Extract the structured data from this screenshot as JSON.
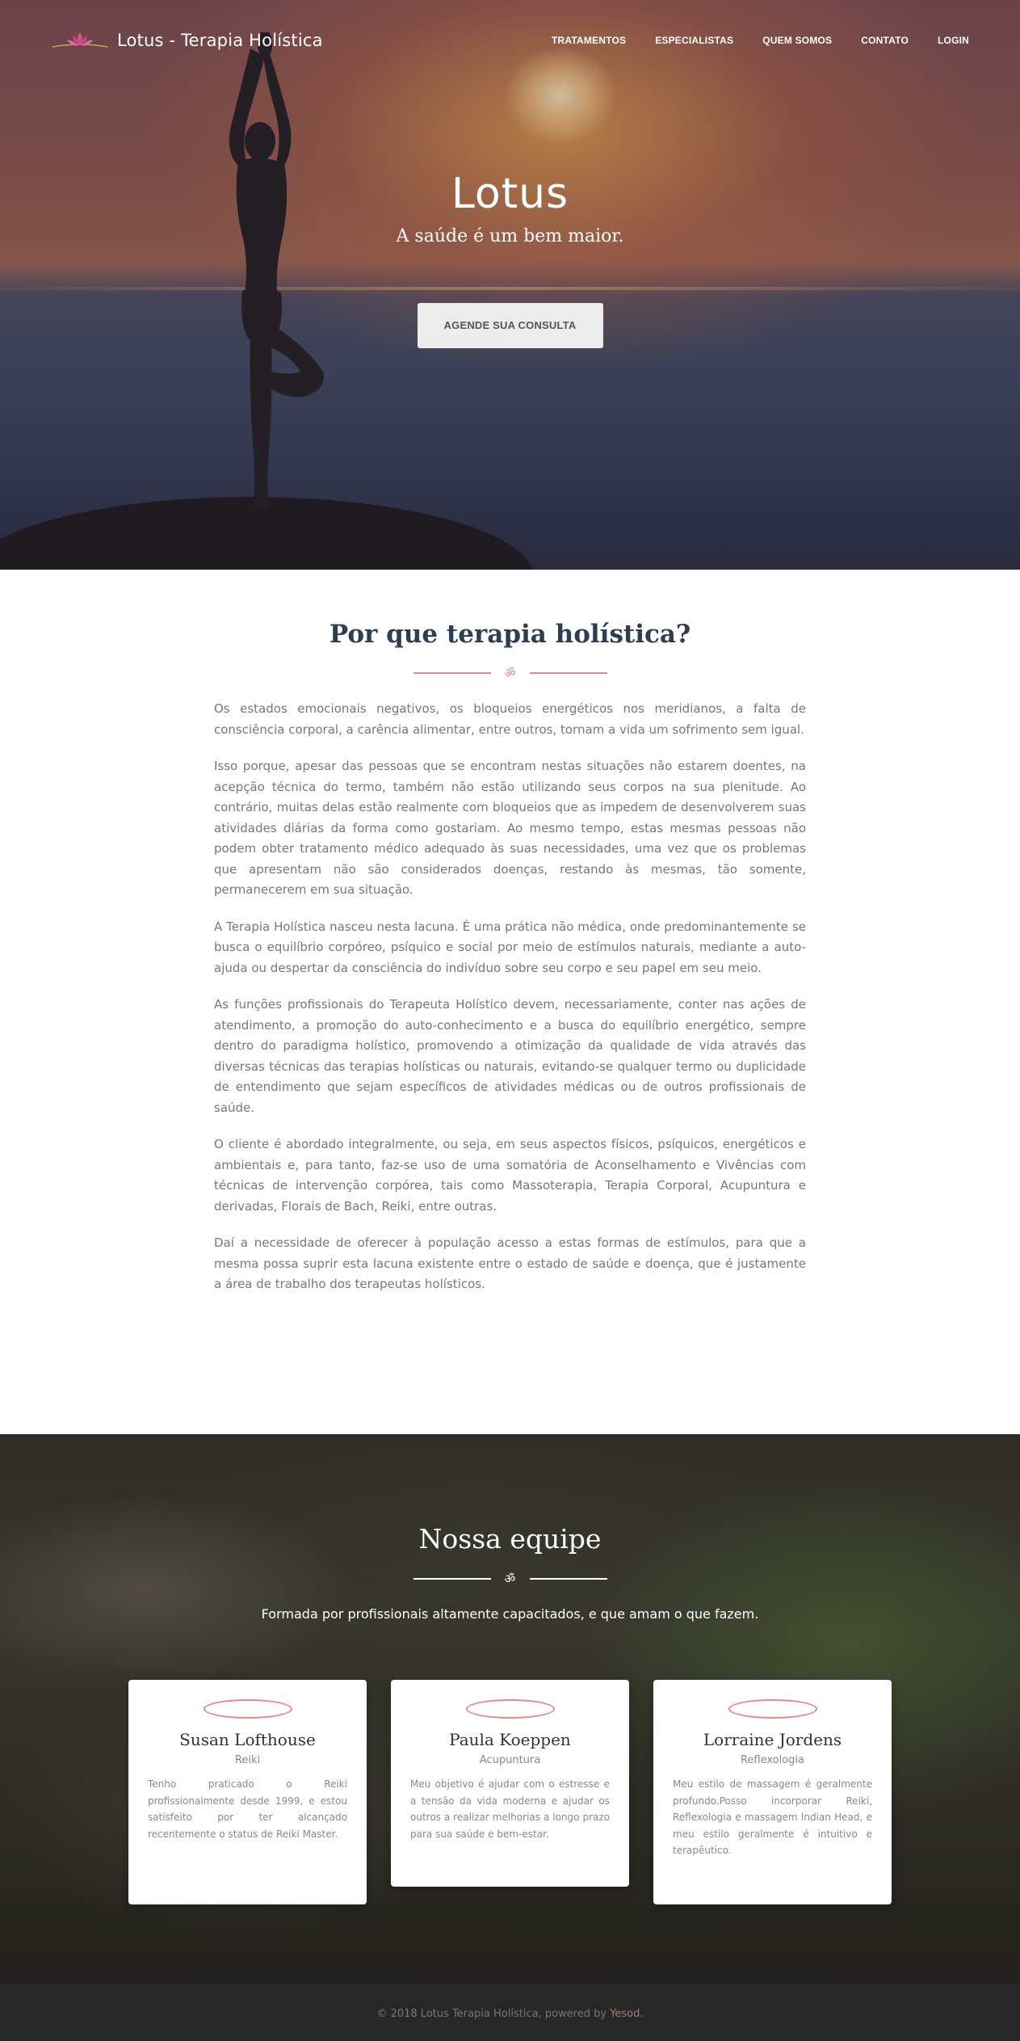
{
  "nav": {
    "brand": "Lotus - Terapia Holística",
    "items": [
      "TRATAMENTOS",
      "ESPECIALISTAS",
      "QUEM SOMOS",
      "CONTATO",
      "LOGIN"
    ]
  },
  "hero": {
    "title": "Lotus",
    "subtitle": "A saúde é um bem maior.",
    "cta": "AGENDE SUA CONSULTA"
  },
  "about": {
    "title": "Por que terapia holística?",
    "symbol": "ॐ",
    "paragraphs": [
      "Os estados emocionais negativos, os bloqueios energéticos nos meridianos, a falta de consciência corporal, a carência alimentar, entre outros, tornam a vida um sofrimento sem igual.",
      "Isso porque, apesar das pessoas que se encontram nestas situações não estarem doentes, na acepção técnica do termo, também não estão utilizando seus corpos na sua plenitude. Ao contrário, muitas delas estão realmente com bloqueios que as impedem de desenvolverem suas atividades diárias da forma como gostariam. Ao mesmo tempo, estas mesmas pessoas não podem obter tratamento médico adequado às suas necessidades, uma vez que os problemas que apresentam não são considerados doenças, restando às mesmas, tão somente, permanecerem em sua situação.",
      "A Terapia Holística nasceu nesta lacuna. É uma prática não médica, onde predominantemente se busca o equilíbrio corpóreo, psíquico e social por meio de estímulos naturais, mediante a auto-ajuda ou despertar da consciência do indivíduo sobre seu corpo e seu papel em seu meio.",
      "As funções profissionais do Terapeuta Holístico devem, necessariamente, conter nas ações de atendimento, a promoção do auto-conhecimento e a busca do equilíbrio energético, sempre dentro do paradigma holístico, promovendo a otimização da qualidade de vida através das diversas técnicas das terapias holísticas ou naturais, evitando-se qualquer termo ou duplicidade de entendimento que sejam específicos de atividades médicas ou de outros profissionais de saúde.",
      "O cliente é abordado integralmente, ou seja, em seus aspectos físicos, psíquicos, energéticos e ambientais e, para tanto, faz-se uso de uma somatória de Aconselhamento e Vivências com técnicas de intervenção corpórea, tais como Massoterapia, Terapia Corporal, Acupuntura e derivadas, Florais de Bach, Reiki, entre outras.",
      "Daí a necessidade de oferecer à população acesso a estas formas de estímulos, para que a mesma possa suprir esta lacuna existente entre o estado de saúde e doença, que é justamente a área de trabalho dos terapeutas holísticos."
    ]
  },
  "team": {
    "title": "Nossa equipe",
    "symbol": "ॐ",
    "subtitle": "Formada por profissionais altamente capacitados, e que amam o que fazem.",
    "members": [
      {
        "name": "Susan Lofthouse",
        "role": "Reiki",
        "description": "Tenho praticado o Reiki profissionalmente desde 1999, e estou satisfeito por ter alcançado recentemente o status de Reiki Master."
      },
      {
        "name": "Paula Koeppen",
        "role": "Acupuntura",
        "description": "Meu objetivo é ajudar com o estresse e a tensão da vida moderna e ajudar os outros a realizar melhorias a longo prazo para sua saúde e bem-estar."
      },
      {
        "name": "Lorraine Jordens",
        "role": "Reflexologia",
        "description": "Meu estilo de massagem é geralmente profundo.Posso incorporar Reiki, Reflexologia e massagem Indian Head, e meu estilo geralmente é intuitivo e terapêutico."
      }
    ]
  },
  "footer": {
    "text": "© 2018 Lotus Terapia Holística, powered by ",
    "link": "Yesod",
    "suffix": "."
  },
  "colors": {
    "accent": "#e8868c",
    "heading": "#2c3e50",
    "footer_bg": "#272727"
  }
}
